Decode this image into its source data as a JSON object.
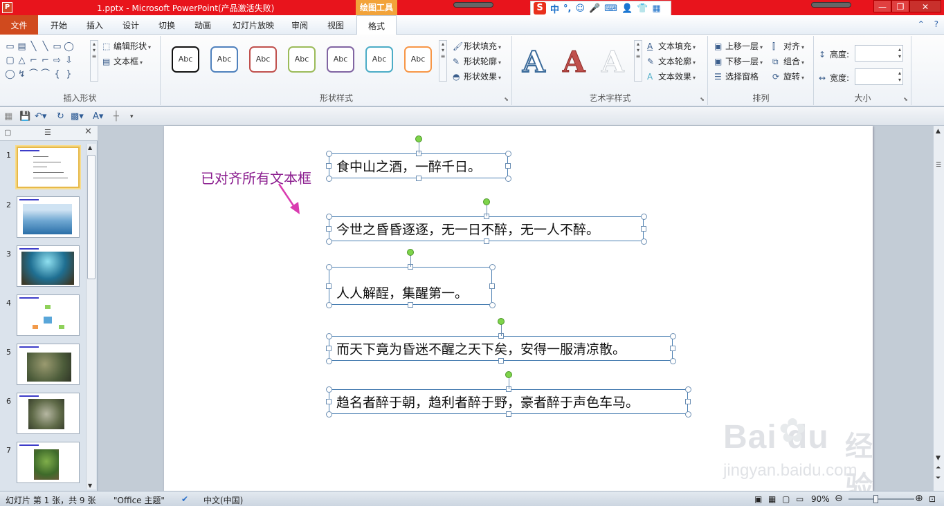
{
  "window": {
    "title": "1.pptx - Microsoft PowerPoint(产品激活失败)",
    "app_icon": "P",
    "contextual_tool_label": "绘图工具",
    "controls": [
      "—",
      "❐",
      "✕"
    ]
  },
  "ime_bar": {
    "logo": "S",
    "items": [
      "中",
      "°,",
      "☺",
      "🎤",
      "⌨",
      "👤",
      "👕",
      "▦"
    ]
  },
  "ribbon_tabs": [
    "文件",
    "开始",
    "插入",
    "设计",
    "切换",
    "动画",
    "幻灯片放映",
    "审阅",
    "视图",
    "格式"
  ],
  "ribbon": {
    "insert_shapes": {
      "label": "插入形状",
      "edit_shape": "编辑形状",
      "text_box": "文本框",
      "shape_glyphs": [
        "▭",
        "▤",
        "╲",
        "╲",
        "▭",
        "◯",
        "",
        "▢",
        "△",
        "⌐",
        "⌐",
        "⇨",
        "⇩",
        "",
        "◯",
        "↯",
        "⌒",
        "⌒",
        "{",
        "}",
        ""
      ]
    },
    "shape_styles": {
      "label": "形状样式",
      "styles": [
        {
          "text": "Abc",
          "color": "#111111"
        },
        {
          "text": "Abc",
          "color": "#4f81bd"
        },
        {
          "text": "Abc",
          "color": "#c0504d"
        },
        {
          "text": "Abc",
          "color": "#9bbb59"
        },
        {
          "text": "Abc",
          "color": "#8064a2"
        },
        {
          "text": "Abc",
          "color": "#4bacc6"
        },
        {
          "text": "Abc",
          "color": "#f79646"
        }
      ],
      "fill": "形状填充",
      "outline": "形状轮廓",
      "effects": "形状效果"
    },
    "wordart": {
      "label": "艺术字样式",
      "letters": [
        "A",
        "A",
        "A"
      ],
      "text_fill": "文本填充",
      "text_outline": "文本轮廓",
      "text_effects": "文本效果"
    },
    "arrange": {
      "label": "排列",
      "bring_forward": "上移一层",
      "send_backward": "下移一层",
      "selection_pane": "选择窗格",
      "align": "对齐",
      "group": "组合",
      "rotate": "旋转"
    },
    "size": {
      "label": "大小",
      "height_label": "高度:",
      "width_label": "宽度:",
      "height_value": "",
      "width_value": ""
    }
  },
  "slides_pane": {
    "slide_numbers": [
      "1",
      "2",
      "3",
      "4",
      "5",
      "6",
      "7"
    ],
    "selected": 1
  },
  "slide": {
    "callout": "已对齐所有文本框",
    "text_boxes": [
      "食中山之酒，一醉千日。",
      "今世之昏昏逐逐，无一日不醉，无一人不醉。",
      "人人解酲，集醒第一。",
      "而天下竟为昏迷不醒之天下矣，安得一服清凉散。",
      "趋名者醉于朝，趋利者醉于野，豪者醉于声色车马。"
    ]
  },
  "statusbar": {
    "slide_info": "幻灯片 第 1 张，共 9 张",
    "theme": "\"Office 主题\"",
    "language": "中文(中国)",
    "zoom": "90%"
  },
  "watermark": {
    "brand": "Bai du",
    "cn": "经验",
    "url": "jingyan.baidu.com"
  },
  "colors": {
    "title_bar": "#e8141c",
    "file_tab": "#d04a1e",
    "tool_tab": "#f2a33a",
    "callout": "#8b1e8f",
    "selection_border": "#4a7fb2",
    "rotate_handle": "#7ed44a"
  }
}
